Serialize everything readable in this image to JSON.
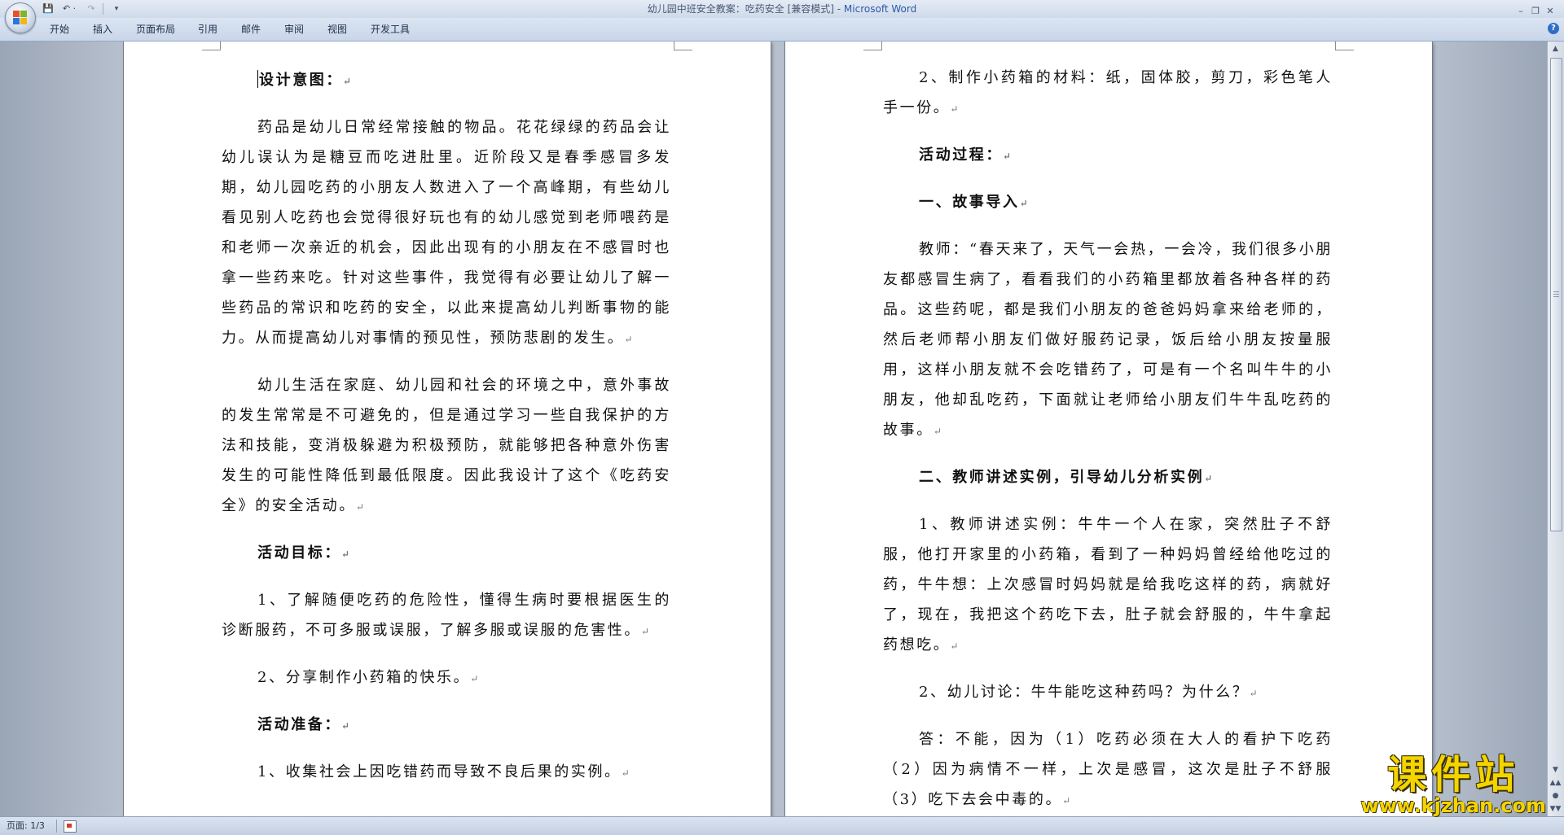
{
  "window": {
    "title": "幼儿园中班安全教案：吃药安全 [兼容模式] - ",
    "app_name": "Microsoft Word"
  },
  "quick_access": {
    "save_icon": "💾",
    "undo_icon": "↶ ·",
    "redo_icon": "↷",
    "more_icon": "▾"
  },
  "window_controls": {
    "minimize": "–",
    "restore": "❐",
    "close": "✕"
  },
  "ribbon": {
    "tabs": [
      "开始",
      "插入",
      "页面布局",
      "引用",
      "邮件",
      "审阅",
      "视图",
      "开发工具"
    ],
    "help": "?"
  },
  "document": {
    "left_page": [
      {
        "text": "设计意图：",
        "heading": true
      },
      {
        "text": "药品是幼儿日常经常接触的物品。花花绿绿的药品会让幼儿误认为是糖豆而吃进肚里。近阶段又是春季感冒多发期，幼儿园吃药的小朋友人数进入了一个高峰期，有些幼儿看见别人吃药也会觉得很好玩也有的幼儿感觉到老师喂药是和老师一次亲近的机会，因此出现有的小朋友在不感冒时也拿一些药来吃。针对这些事件，我觉得有必要让幼儿了解一些药品的常识和吃药的安全，以此来提高幼儿判断事物的能力。从而提高幼儿对事情的预见性，预防悲剧的发生。",
        "heading": false
      },
      {
        "text": "幼儿生活在家庭、幼儿园和社会的环境之中，意外事故的发生常常是不可避免的，但是通过学习一些自我保护的方法和技能，变消极躲避为积极预防，就能够把各种意外伤害发生的可能性降低到最低限度。因此我设计了这个《吃药安全》的安全活动。",
        "heading": false
      },
      {
        "text": "活动目标：",
        "heading": true
      },
      {
        "text": "1、了解随便吃药的危险性，懂得生病时要根据医生的诊断服药，不可多服或误服，了解多服或误服的危害性。",
        "heading": false
      },
      {
        "text": "2、分享制作小药箱的快乐。",
        "heading": false
      },
      {
        "text": "活动准备：",
        "heading": true
      },
      {
        "text": "1、收集社会上因吃错药而导致不良后果的实例。",
        "heading": false
      }
    ],
    "right_page": [
      {
        "text": "2、制作小药箱的材料：纸，固体胶，剪刀，彩色笔人手一份。",
        "heading": false
      },
      {
        "text": "活动过程：",
        "heading": true
      },
      {
        "text": "一、故事导入",
        "heading": true
      },
      {
        "text": "教师：“春天来了，天气一会热，一会冷，我们很多小朋友都感冒生病了，看看我们的小药箱里都放着各种各样的药品。这些药呢，都是我们小朋友的爸爸妈妈拿来给老师的，然后老师帮小朋友们做好服药记录，饭后给小朋友按量服用，这样小朋友就不会吃错药了，可是有一个名叫牛牛的小朋友，他却乱吃药，下面就让老师给小朋友们牛牛乱吃药的故事。",
        "heading": false
      },
      {
        "text": "二、教师讲述实例，引导幼儿分析实例",
        "heading": true
      },
      {
        "text": "1、教师讲述实例：牛牛一个人在家，突然肚子不舒服，他打开家里的小药箱，看到了一种妈妈曾经给他吃过的药，牛牛想：上次感冒时妈妈就是给我吃这样的药，病就好了，现在，我把这个药吃下去，肚子就会舒服的，牛牛拿起药想吃。",
        "heading": false
      },
      {
        "text": "2、幼儿讨论：牛牛能吃这种药吗？为什么？",
        "heading": false
      },
      {
        "text": "答：不能，因为（1）吃药必须在大人的看护下吃药（2）因为病情不一样，上次是感冒，这次是肚子不舒服（3）吃下去会中毒的。",
        "heading": false
      }
    ],
    "paragraph_mark": "↵"
  },
  "scrollbar": {
    "up_arrow": "▲",
    "down_arrow": "▼",
    "page_up": "▲▲",
    "page_down": "▼▼"
  },
  "status": {
    "page_info": "页面: 1/3"
  },
  "watermark": {
    "title": "课件站",
    "url": "www.kjzhan.com"
  }
}
